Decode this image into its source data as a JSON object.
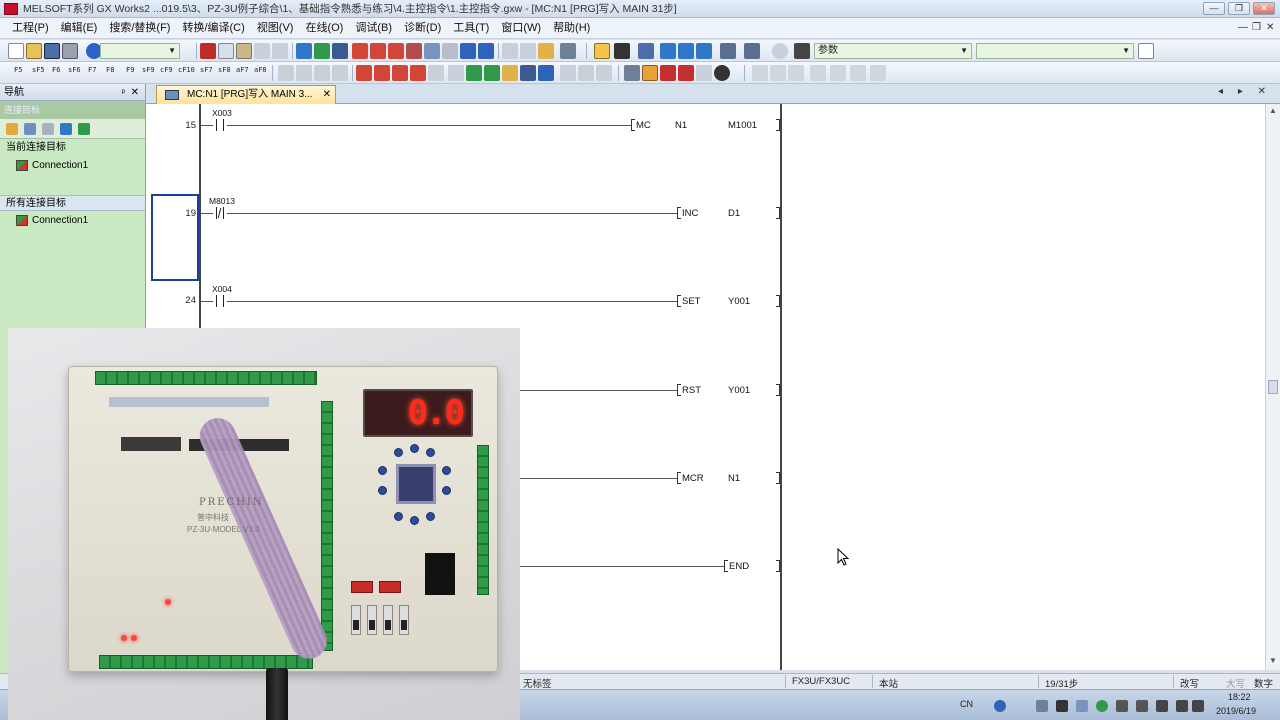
{
  "window": {
    "title": "MELSOFT系列 GX Works2 ...019.5\\3、PZ-3U例子综合\\1、基础指令熟悉与练习\\4.主控指令\\1.主控指令.gxw - [MC:N1 [PRG]写入 MAIN 31步]",
    "min": "—",
    "max": "❐",
    "close": "✕"
  },
  "menu": {
    "items": [
      "工程(P)",
      "编辑(E)",
      "搜索/替换(F)",
      "转换/编译(C)",
      "视图(V)",
      "在线(O)",
      "调试(B)",
      "诊断(D)",
      "工具(T)",
      "窗口(W)",
      "帮助(H)"
    ],
    "mdi_controls": [
      "—",
      "❐",
      "✕"
    ]
  },
  "toolbar": {
    "param_combo": "参数",
    "fkeys": [
      "F5",
      "sF5",
      "F6",
      "sF6",
      "F7",
      "F8",
      "F9",
      "sF9",
      "cF9",
      "cF10",
      "sF7",
      "sF8",
      "aF7",
      "aF8",
      "F10"
    ]
  },
  "navigation": {
    "title": "导航",
    "pin": "ᵖ",
    "close": "✕",
    "subheader": "连接目标",
    "current_group": "当前连接目标",
    "current_item": "Connection1",
    "all_group": "所有连接目标",
    "all_item": "Connection1"
  },
  "tab": {
    "label": "MC:N1 [PRG]写入 MAIN 3...",
    "close": "✕",
    "arrows": "◂ ▸ ✕"
  },
  "ladder": {
    "rungs": [
      {
        "step": "15",
        "contact": "X003",
        "instr": "MC",
        "op1": "N1",
        "op2": "M1001"
      },
      {
        "step": "19",
        "contact": "M8013",
        "instr": "INC",
        "op1": "D1",
        "op2": ""
      },
      {
        "step": "24",
        "contact": "X004",
        "instr": "SET",
        "op1": "Y001",
        "op2": ""
      },
      {
        "step": "",
        "contact": "",
        "instr": "RST",
        "op1": "Y001",
        "op2": ""
      },
      {
        "step": "",
        "contact": "",
        "instr": "MCR",
        "op1": "N1",
        "op2": ""
      },
      {
        "step": "",
        "contact": "",
        "instr": "END",
        "op1": "",
        "op2": ""
      }
    ]
  },
  "status": {
    "label": "无标签",
    "plc_type": "FX3U/FX3UC",
    "station": "本站",
    "steps": "19/31步",
    "mode": "改写",
    "caps": "大写",
    "num": "数字"
  },
  "photo": {
    "display_value": "0.0",
    "brand": "PRECHIN",
    "brand_cn": "普中科技",
    "model": "PZ-3U-MODEL V3.0"
  },
  "taskbar": {
    "ime": "CN",
    "time": "18:22",
    "date": "2019/6/19"
  },
  "colors": {
    "nav_bg": "#c9e9c2",
    "tab_bg": "#ffe39a",
    "cursor_box": "#1a3fa6",
    "display_red": "#ff2a1a"
  }
}
